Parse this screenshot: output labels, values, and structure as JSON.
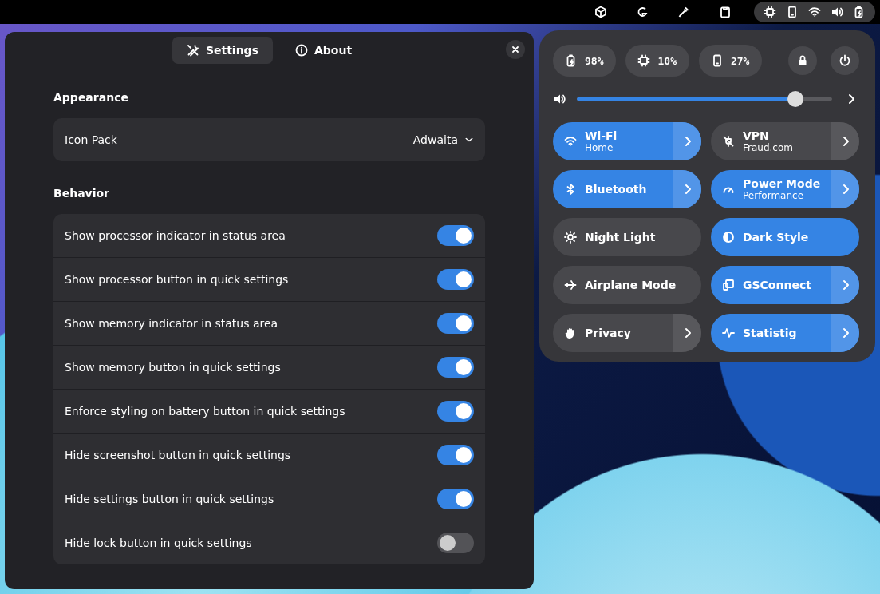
{
  "quick_settings": {
    "status_pills": [
      {
        "label": "98%"
      },
      {
        "label": "10%"
      },
      {
        "label": "27%"
      }
    ],
    "volume": {
      "level": 0.88
    },
    "toggles": [
      {
        "label": "Wi-Fi",
        "subtitle": "Home",
        "on": true,
        "has_menu": true
      },
      {
        "label": "VPN",
        "subtitle": "Fraud.com",
        "on": false,
        "has_menu": true
      },
      {
        "label": "Bluetooth",
        "on": true,
        "has_menu": true
      },
      {
        "label": "Power Mode",
        "subtitle": "Performance",
        "on": true,
        "has_menu": true
      },
      {
        "label": "Night Light",
        "on": false,
        "has_menu": false
      },
      {
        "label": "Dark Style",
        "on": true,
        "has_menu": false
      },
      {
        "label": "Airplane Mode",
        "on": false,
        "has_menu": false
      },
      {
        "label": "GSConnect",
        "on": true,
        "has_menu": true
      },
      {
        "label": "Privacy",
        "on": false,
        "has_menu": true
      },
      {
        "label": "Statistig",
        "on": true,
        "has_menu": true
      }
    ]
  },
  "settings_window": {
    "tabs": [
      {
        "label": "Settings",
        "selected": true
      },
      {
        "label": "About",
        "selected": false
      }
    ],
    "sections": [
      {
        "title": "Appearance",
        "rows": [
          {
            "kind": "dropdown",
            "label": "Icon Pack",
            "value": "Adwaita"
          }
        ]
      },
      {
        "title": "Behavior",
        "rows": [
          {
            "kind": "switch",
            "label": "Show processor indicator in status area",
            "on": true
          },
          {
            "kind": "switch",
            "label": "Show processor button in quick settings",
            "on": true
          },
          {
            "kind": "switch",
            "label": "Show memory indicator in status area",
            "on": true
          },
          {
            "kind": "switch",
            "label": "Show memory button in quick settings",
            "on": true
          },
          {
            "kind": "switch",
            "label": "Enforce styling on battery button in quick settings",
            "on": true
          },
          {
            "kind": "switch",
            "label": "Hide screenshot button in quick settings",
            "on": true
          },
          {
            "kind": "switch",
            "label": "Hide settings button in quick settings",
            "on": true
          },
          {
            "kind": "switch",
            "label": "Hide lock button in quick settings",
            "on": false
          }
        ]
      }
    ]
  }
}
